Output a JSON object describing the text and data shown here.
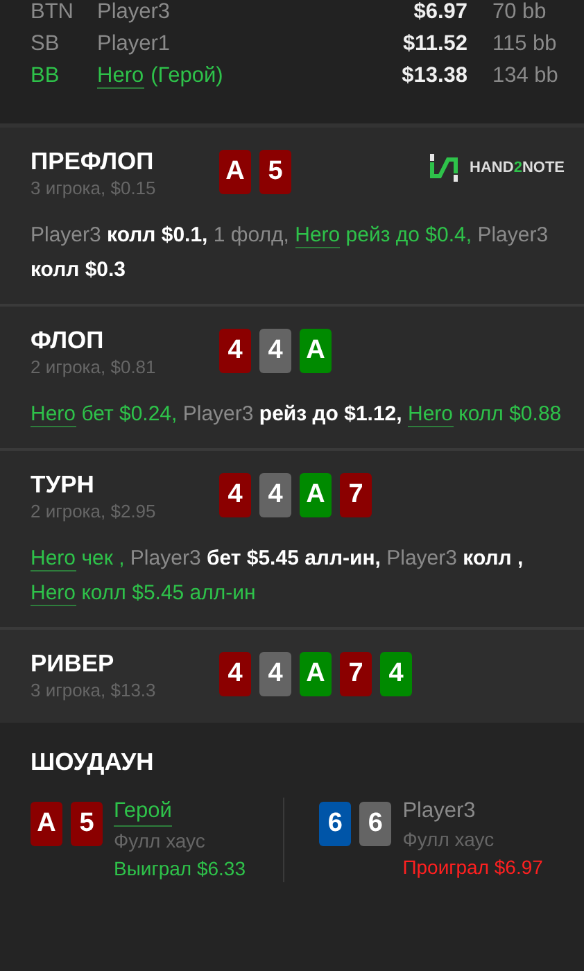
{
  "players": [
    {
      "position": "BTN",
      "name": "Player3",
      "stack": "$6.97",
      "bb": "70 bb",
      "hero": false
    },
    {
      "position": "SB",
      "name": "Player1",
      "stack": "$11.52",
      "bb": "115 bb",
      "hero": false
    },
    {
      "position": "BB",
      "name": "Hero",
      "suffix": "(Герой)",
      "stack": "$13.38",
      "bb": "134 bb",
      "hero": true
    }
  ],
  "streets": [
    {
      "title": "ПРЕФЛОП",
      "info": "3 игрока, $0.15",
      "logo": {
        "before": "HAND",
        "accent": "2",
        "after": "NOTE"
      },
      "cards": [
        {
          "rank": "A",
          "color": "#8b0000"
        },
        {
          "rank": "5",
          "color": "#8b0000"
        }
      ],
      "actions": [
        {
          "kind": "player",
          "text": "Player3"
        },
        {
          "kind": "action",
          "text": "колл $0.1,"
        },
        {
          "kind": "info",
          "text": "1 фолд,"
        },
        {
          "kind": "hero",
          "text": "Hero"
        },
        {
          "kind": "hero_action",
          "text": "рейз до $0.4,"
        },
        {
          "kind": "player",
          "text": "Player3"
        },
        {
          "kind": "action",
          "text": "колл $0.3"
        }
      ]
    },
    {
      "title": "ФЛОП",
      "info": "2 игрока, $0.81",
      "cards": [
        {
          "rank": "4",
          "color": "#8b0000"
        },
        {
          "rank": "4",
          "color": "#646464"
        },
        {
          "rank": "A",
          "color": "#008a00"
        }
      ],
      "actions": [
        {
          "kind": "hero",
          "text": "Hero"
        },
        {
          "kind": "hero_action",
          "text": "бет $0.24,"
        },
        {
          "kind": "player",
          "text": "Player3"
        },
        {
          "kind": "action",
          "text": "рейз до $1.12,"
        },
        {
          "kind": "hero",
          "text": "Hero"
        },
        {
          "kind": "hero_action",
          "text": "колл $0.88"
        }
      ]
    },
    {
      "title": "ТУРН",
      "info": "2 игрока, $2.95",
      "cards": [
        {
          "rank": "4",
          "color": "#8b0000"
        },
        {
          "rank": "4",
          "color": "#646464"
        },
        {
          "rank": "A",
          "color": "#008a00"
        },
        {
          "rank": "7",
          "color": "#8b0000"
        }
      ],
      "actions": [
        {
          "kind": "hero",
          "text": "Hero"
        },
        {
          "kind": "hero_action",
          "text": "чек ,"
        },
        {
          "kind": "player",
          "text": "Player3"
        },
        {
          "kind": "action",
          "text": "бет $5.45 алл-ин,"
        },
        {
          "kind": "player",
          "text": "Player3"
        },
        {
          "kind": "action",
          "text": "колл ,"
        },
        {
          "kind": "hero",
          "text": "Hero"
        },
        {
          "kind": "hero_action",
          "text": "колл $5.45 алл-ин"
        }
      ]
    },
    {
      "title": "РИВЕР",
      "info": "3 игрока, $13.3",
      "cards": [
        {
          "rank": "4",
          "color": "#8b0000"
        },
        {
          "rank": "4",
          "color": "#646464"
        },
        {
          "rank": "A",
          "color": "#008a00"
        },
        {
          "rank": "7",
          "color": "#8b0000"
        },
        {
          "rank": "4",
          "color": "#008a00"
        }
      ]
    }
  ],
  "showdown": {
    "title": "ШОУДАУН",
    "hands": [
      {
        "name": "Герой",
        "hero": true,
        "combo": "Фулл хаус",
        "result": "Выиграл $6.33",
        "won": true,
        "cards": [
          {
            "rank": "A",
            "color": "#8b0000"
          },
          {
            "rank": "5",
            "color": "#8b0000"
          }
        ]
      },
      {
        "name": "Player3",
        "hero": false,
        "combo": "Фулл хаус",
        "result": "Проиграл $6.97",
        "won": false,
        "cards": [
          {
            "rank": "6",
            "color": "#0055a8"
          },
          {
            "rank": "6",
            "color": "#646464"
          }
        ]
      }
    ]
  }
}
